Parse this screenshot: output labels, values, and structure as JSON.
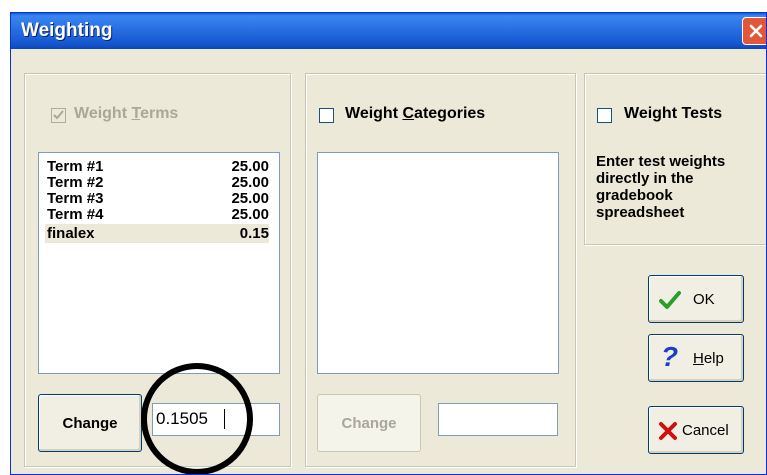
{
  "window": {
    "title": "Weighting"
  },
  "terms": {
    "label": "Weight Terms",
    "checked": true,
    "enabled": false,
    "items": [
      {
        "name": "Term #1",
        "value": "25.00"
      },
      {
        "name": "Term #2",
        "value": "25.00"
      },
      {
        "name": "Term #3",
        "value": "25.00"
      },
      {
        "name": "Term #4",
        "value": "25.00"
      },
      {
        "name": "finalex",
        "value": "0.15"
      }
    ],
    "change_label": "Change",
    "edit_value": "0.1505"
  },
  "categories": {
    "label": "Weight Categories",
    "checked": false,
    "change_label": "Change",
    "edit_value": ""
  },
  "tests": {
    "label": "Weight Tests",
    "checked": false,
    "note": "Enter test weights directly in the gradebook spreadsheet"
  },
  "buttons": {
    "ok": "OK",
    "help": "Help",
    "cancel": "Cancel"
  },
  "colors": {
    "titlebar": "#2b72e6",
    "dialog": "#ece9d8",
    "ok_check": "#2a9d2a",
    "help_mark": "#1a3ccf",
    "cancel_x": "#d01010"
  },
  "icons": {
    "ok": "checkmark-icon",
    "help": "question-mark-icon",
    "cancel": "x-icon",
    "close": "close-icon"
  }
}
